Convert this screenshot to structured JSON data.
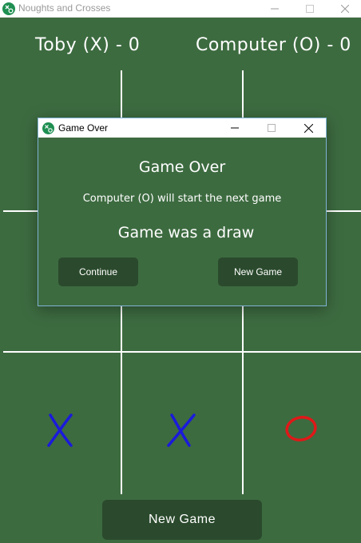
{
  "window": {
    "title": "Noughts and Crosses",
    "controls": [
      "minimize-icon",
      "maximize-icon",
      "close-icon"
    ]
  },
  "scoreboard": {
    "player": "Toby (X) - 0",
    "computer": "Computer (O) - 0"
  },
  "board": {
    "cells": [
      "",
      "",
      "",
      "",
      "",
      "",
      "X",
      "X",
      "O"
    ],
    "x_color": "#1a1adb",
    "o_color": "#e01818",
    "line_color": "#ffffff"
  },
  "new_game_button": "New Game",
  "dialog": {
    "title": "Game Over",
    "heading": "Game Over",
    "next_starter": "Computer (O) will start the next game",
    "result": "Game was a draw",
    "continue_label": "Continue",
    "new_game_label": "New Game"
  },
  "colors": {
    "background": "#3d6b40",
    "button": "#2b4a2d"
  }
}
